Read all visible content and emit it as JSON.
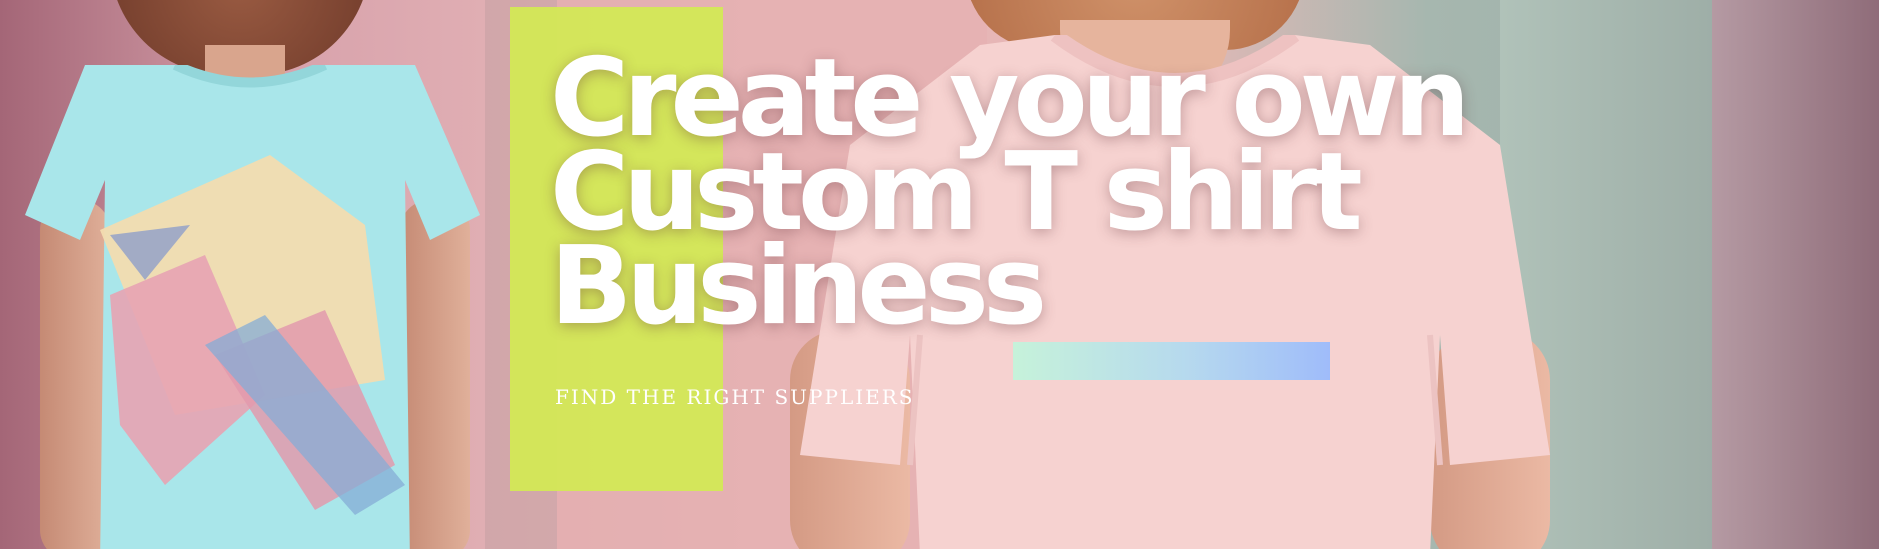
{
  "banner": {
    "headline_lines": [
      "Create your own",
      "Custom T shirt",
      "Business"
    ],
    "subtitle": "FIND THE RIGHT SUPPLIERS",
    "accent_colors": {
      "lime_block": "#d3ea54",
      "bar_gradient_start": "#c6f2da",
      "bar_gradient_end": "#9fbcfa",
      "text": "#ffffff"
    },
    "scene": {
      "left_model_shirt": "light-blue t-shirt with pastel geometric print",
      "right_model_shirt": "plain pale pink t-shirt"
    }
  }
}
